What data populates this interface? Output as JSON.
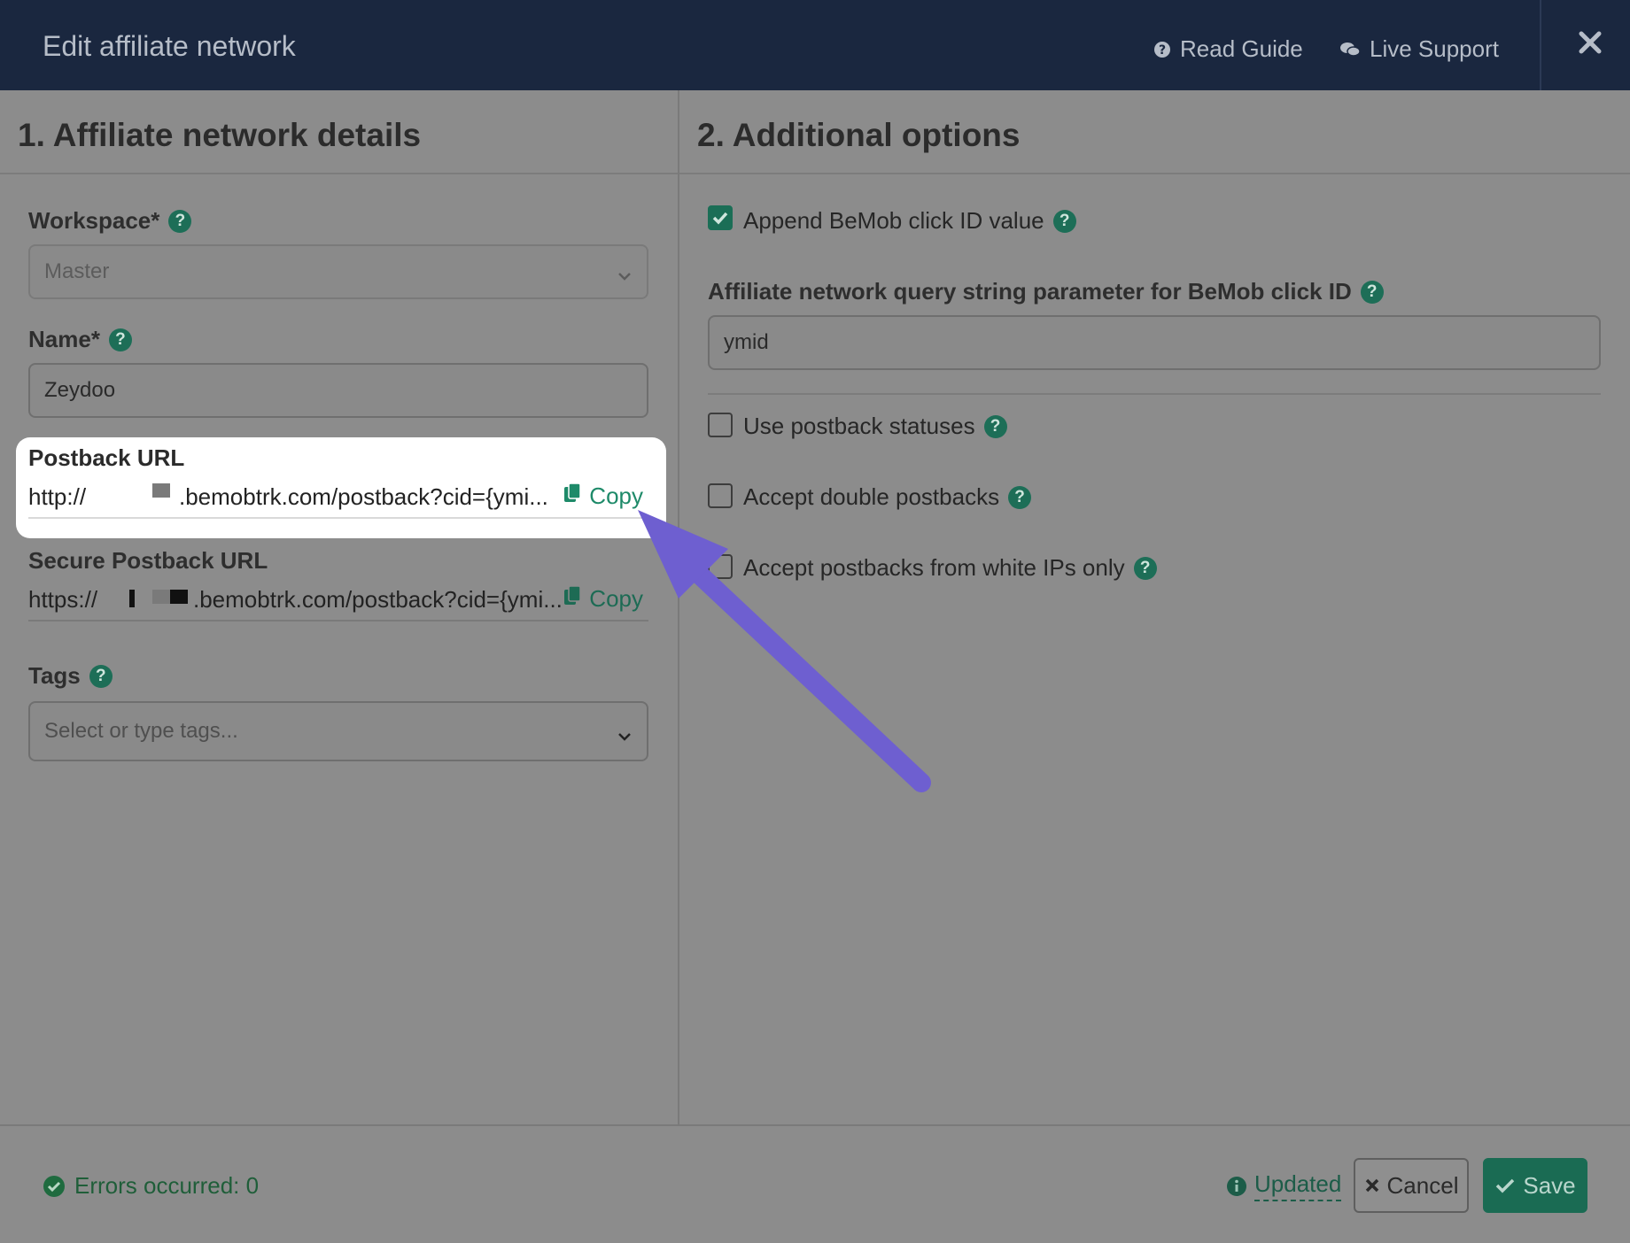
{
  "header": {
    "title": "Edit affiliate network",
    "read_guide": "Read Guide",
    "live_support": "Live Support"
  },
  "left": {
    "section_title": "1. Affiliate network details",
    "workspace_label": "Workspace*",
    "workspace_value": "Master",
    "name_label": "Name*",
    "name_value": "Zeydoo",
    "postback_label": "Postback URL",
    "postback_prefix": "http://",
    "postback_suffix": ".bemobtrk.com/postback?cid={ymi...",
    "secure_label": "Secure Postback URL",
    "secure_prefix": "https://",
    "secure_suffix": ".bemobtrk.com/postback?cid={ymi...",
    "copy_label": "Copy",
    "tags_label": "Tags",
    "tags_placeholder": "Select or type tags..."
  },
  "right": {
    "section_title": "2. Additional options",
    "append_label": "Append BeMob click ID value",
    "append_checked": true,
    "param_label": "Affiliate network query string parameter for BeMob click ID",
    "param_value": "ymid",
    "statuses_label": "Use postback statuses",
    "double_label": "Accept double postbacks",
    "white_ips_label": "Accept postbacks from white IPs only"
  },
  "footer": {
    "errors": "Errors occurred: 0",
    "updated": "Updated",
    "cancel": "Cancel",
    "save": "Save"
  },
  "colors": {
    "header_bg": "#1a273f",
    "accent_green": "#1d6e57",
    "annotation_arrow": "#6e5fd0"
  }
}
